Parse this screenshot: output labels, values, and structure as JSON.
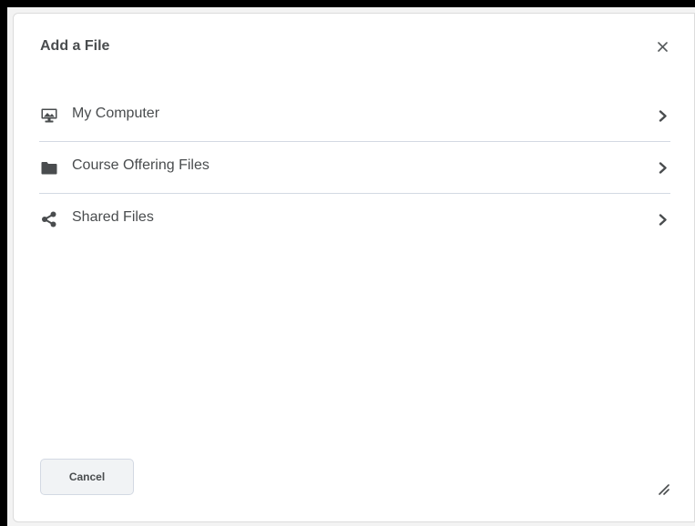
{
  "dialog": {
    "title": "Add a File",
    "close_icon": "close-icon",
    "options": [
      {
        "label": "My Computer",
        "icon": "computer-icon"
      },
      {
        "label": "Course Offering Files",
        "icon": "folder-icon"
      },
      {
        "label": "Shared Files",
        "icon": "share-icon"
      }
    ],
    "cancel_label": "Cancel",
    "resize_icon": "resize-handle-icon"
  },
  "colors": {
    "text": "#494c4e",
    "divider": "#d3d9e3",
    "button_bg": "#f1f3f5",
    "frame": "#000000"
  }
}
